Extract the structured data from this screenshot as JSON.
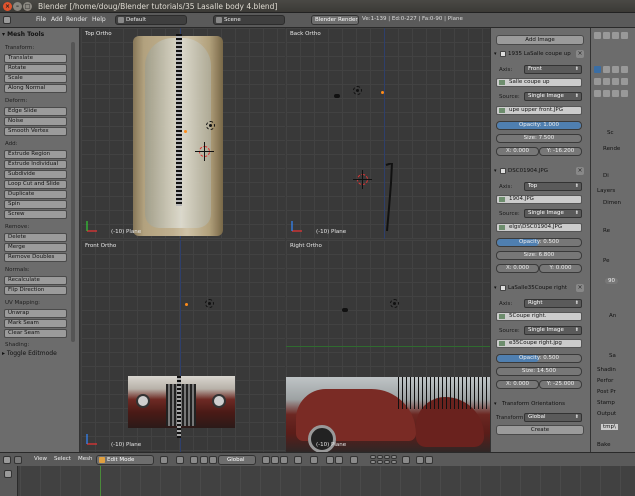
{
  "window": {
    "title": "Blender [/home/doug/Blender tutorials/35 Lasalle body 4.blend]"
  },
  "info_header": {
    "menus": [
      "File",
      "Add",
      "Render",
      "Help"
    ],
    "screen_layout": "Default",
    "scene": "Scene",
    "render_engine": "Blender Render",
    "stats": "Ve:1-139 | Ed:0-227 | Fa:0-90 | Plane"
  },
  "tool_shelf": {
    "title": "Mesh Tools",
    "sections": [
      {
        "label": "Transform:",
        "buttons": [
          "Translate",
          "Rotate",
          "Scale",
          "Along Normal"
        ]
      },
      {
        "label": "Deform:",
        "buttons": [
          "Edge Slide",
          "Noise",
          "Smooth Vertex"
        ]
      },
      {
        "label": "Add:",
        "buttons": [
          "Extrude Region",
          "Extrude Individual",
          "Subdivide",
          "Loop Cut and Slide",
          "Duplicate",
          "Spin",
          "Screw"
        ]
      },
      {
        "label": "Remove:",
        "buttons": [
          "Delete",
          "Merge",
          "Remove Doubles"
        ]
      },
      {
        "label": "Normals:",
        "buttons": [
          "Recalculate",
          "Flip Direction"
        ]
      },
      {
        "label": "UV Mapping:",
        "buttons": [
          "Unwrap",
          "Mark Seam",
          "Clear Seam"
        ]
      },
      {
        "label": "Shading:",
        "buttons": []
      }
    ],
    "footer": "Toggle Editmode"
  },
  "viewports": [
    {
      "name": "Top Ortho",
      "object": "(-10) Plane"
    },
    {
      "name": "Back Ortho",
      "object": "(-10) Plane"
    },
    {
      "name": "Front Ortho",
      "object": "(-10) Plane"
    },
    {
      "name": "Right Ortho",
      "object": "(-10) Plane"
    }
  ],
  "bg_panel": {
    "add_image": "Add Image",
    "images": [
      {
        "name": "1935 LaSalle coupe up",
        "axis": "Front",
        "file": "Salle coupe up",
        "source": "Single Image",
        "path": "upe upper front.JPG",
        "opacity": "Opacity: 1.000",
        "opacity_value": 1.0,
        "size": "Size: 7.500",
        "x": "X: 0.000",
        "y": "Y: -16.200"
      },
      {
        "name": "DSC01904.JPG",
        "axis": "Top",
        "file": "1904.JPG",
        "source": "Single Image",
        "path": "elgs\\DSC01904.JPG",
        "opacity": "Opacity: 0.500",
        "opacity_value": 0.5,
        "size": "Size: 6.800",
        "x": "X: 0.000",
        "y": "Y: 0.000"
      },
      {
        "name": "LaSalle35Coupe right",
        "axis": "Right",
        "file": "5Coupe right.",
        "source": "Single Image",
        "path": "e35Coupe right.jpg",
        "opacity": "Opacity: 0.500",
        "opacity_value": 0.5,
        "size": "Size: 14.500",
        "x": "X: 0.000",
        "y": "Y: -25.000"
      }
    ],
    "labels": {
      "axis": "Axis:",
      "source": "Source:"
    },
    "transform_orientations": {
      "title": "Transform Orientations",
      "label": "Transform:",
      "value": "Global",
      "create": "Create"
    }
  },
  "props_panel": {
    "items": [
      "Sc",
      "Rende",
      "Di",
      "Layers",
      "Dimen",
      "Re",
      "Pe",
      "An",
      "Sa",
      "Shadin",
      "Perfor",
      "Post Pr",
      "Stamp",
      "Output",
      "tmp\\",
      "Bake"
    ],
    "field_value": "90"
  },
  "view_header": {
    "menus": [
      "View",
      "Select",
      "Mesh"
    ],
    "mode": "Edit Mode",
    "orientation": "Global"
  }
}
